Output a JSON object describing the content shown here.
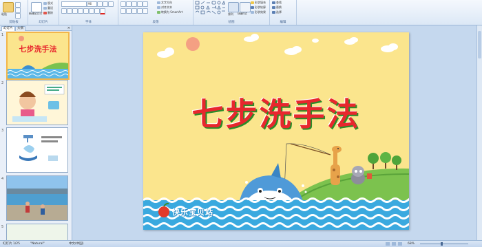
{
  "ribbon": {
    "groups": [
      {
        "label": "剪贴板"
      },
      {
        "label": "幻灯片"
      },
      {
        "label": "字体"
      },
      {
        "label": "段落"
      },
      {
        "label": "绘图"
      },
      {
        "label": "编辑"
      }
    ],
    "paste_label": "粘贴",
    "new_slide_label": "新建幻灯片",
    "layout_label": "版式",
    "reset_label": "重设",
    "delete_label": "删除",
    "font_name": "",
    "font_size": "96",
    "text_direction_label": "文字方向",
    "align_text_label": "对齐文本",
    "smartart_label": "转换为 SmartArt",
    "arrange_label": "排列",
    "quick_styles_label": "快速样式",
    "shape_fill_label": "形状填充",
    "shape_outline_label": "形状轮廓",
    "shape_effects_label": "形状效果",
    "find_label": "查找",
    "replace_label": "替换",
    "select_label": "选择"
  },
  "panel": {
    "tabs": [
      "幻灯片",
      "大纲"
    ],
    "thumbs": [
      {
        "num": "1",
        "title": "七步洗手法"
      },
      {
        "num": "2"
      },
      {
        "num": "3"
      },
      {
        "num": "4"
      },
      {
        "num": "5"
      }
    ]
  },
  "slide": {
    "title": "七步洗手法",
    "logo_text": "快乐宝贝站"
  },
  "status": {
    "slide_info": "幻灯片 1/25",
    "theme": "\"Natural\"",
    "language": "中文(中国)",
    "zoom": "68%"
  },
  "colors": {
    "title": "#e8272d",
    "title_shadow": "#2b8c2a",
    "slide_bg": "#fbe58d",
    "wave": "#3aa9df"
  }
}
